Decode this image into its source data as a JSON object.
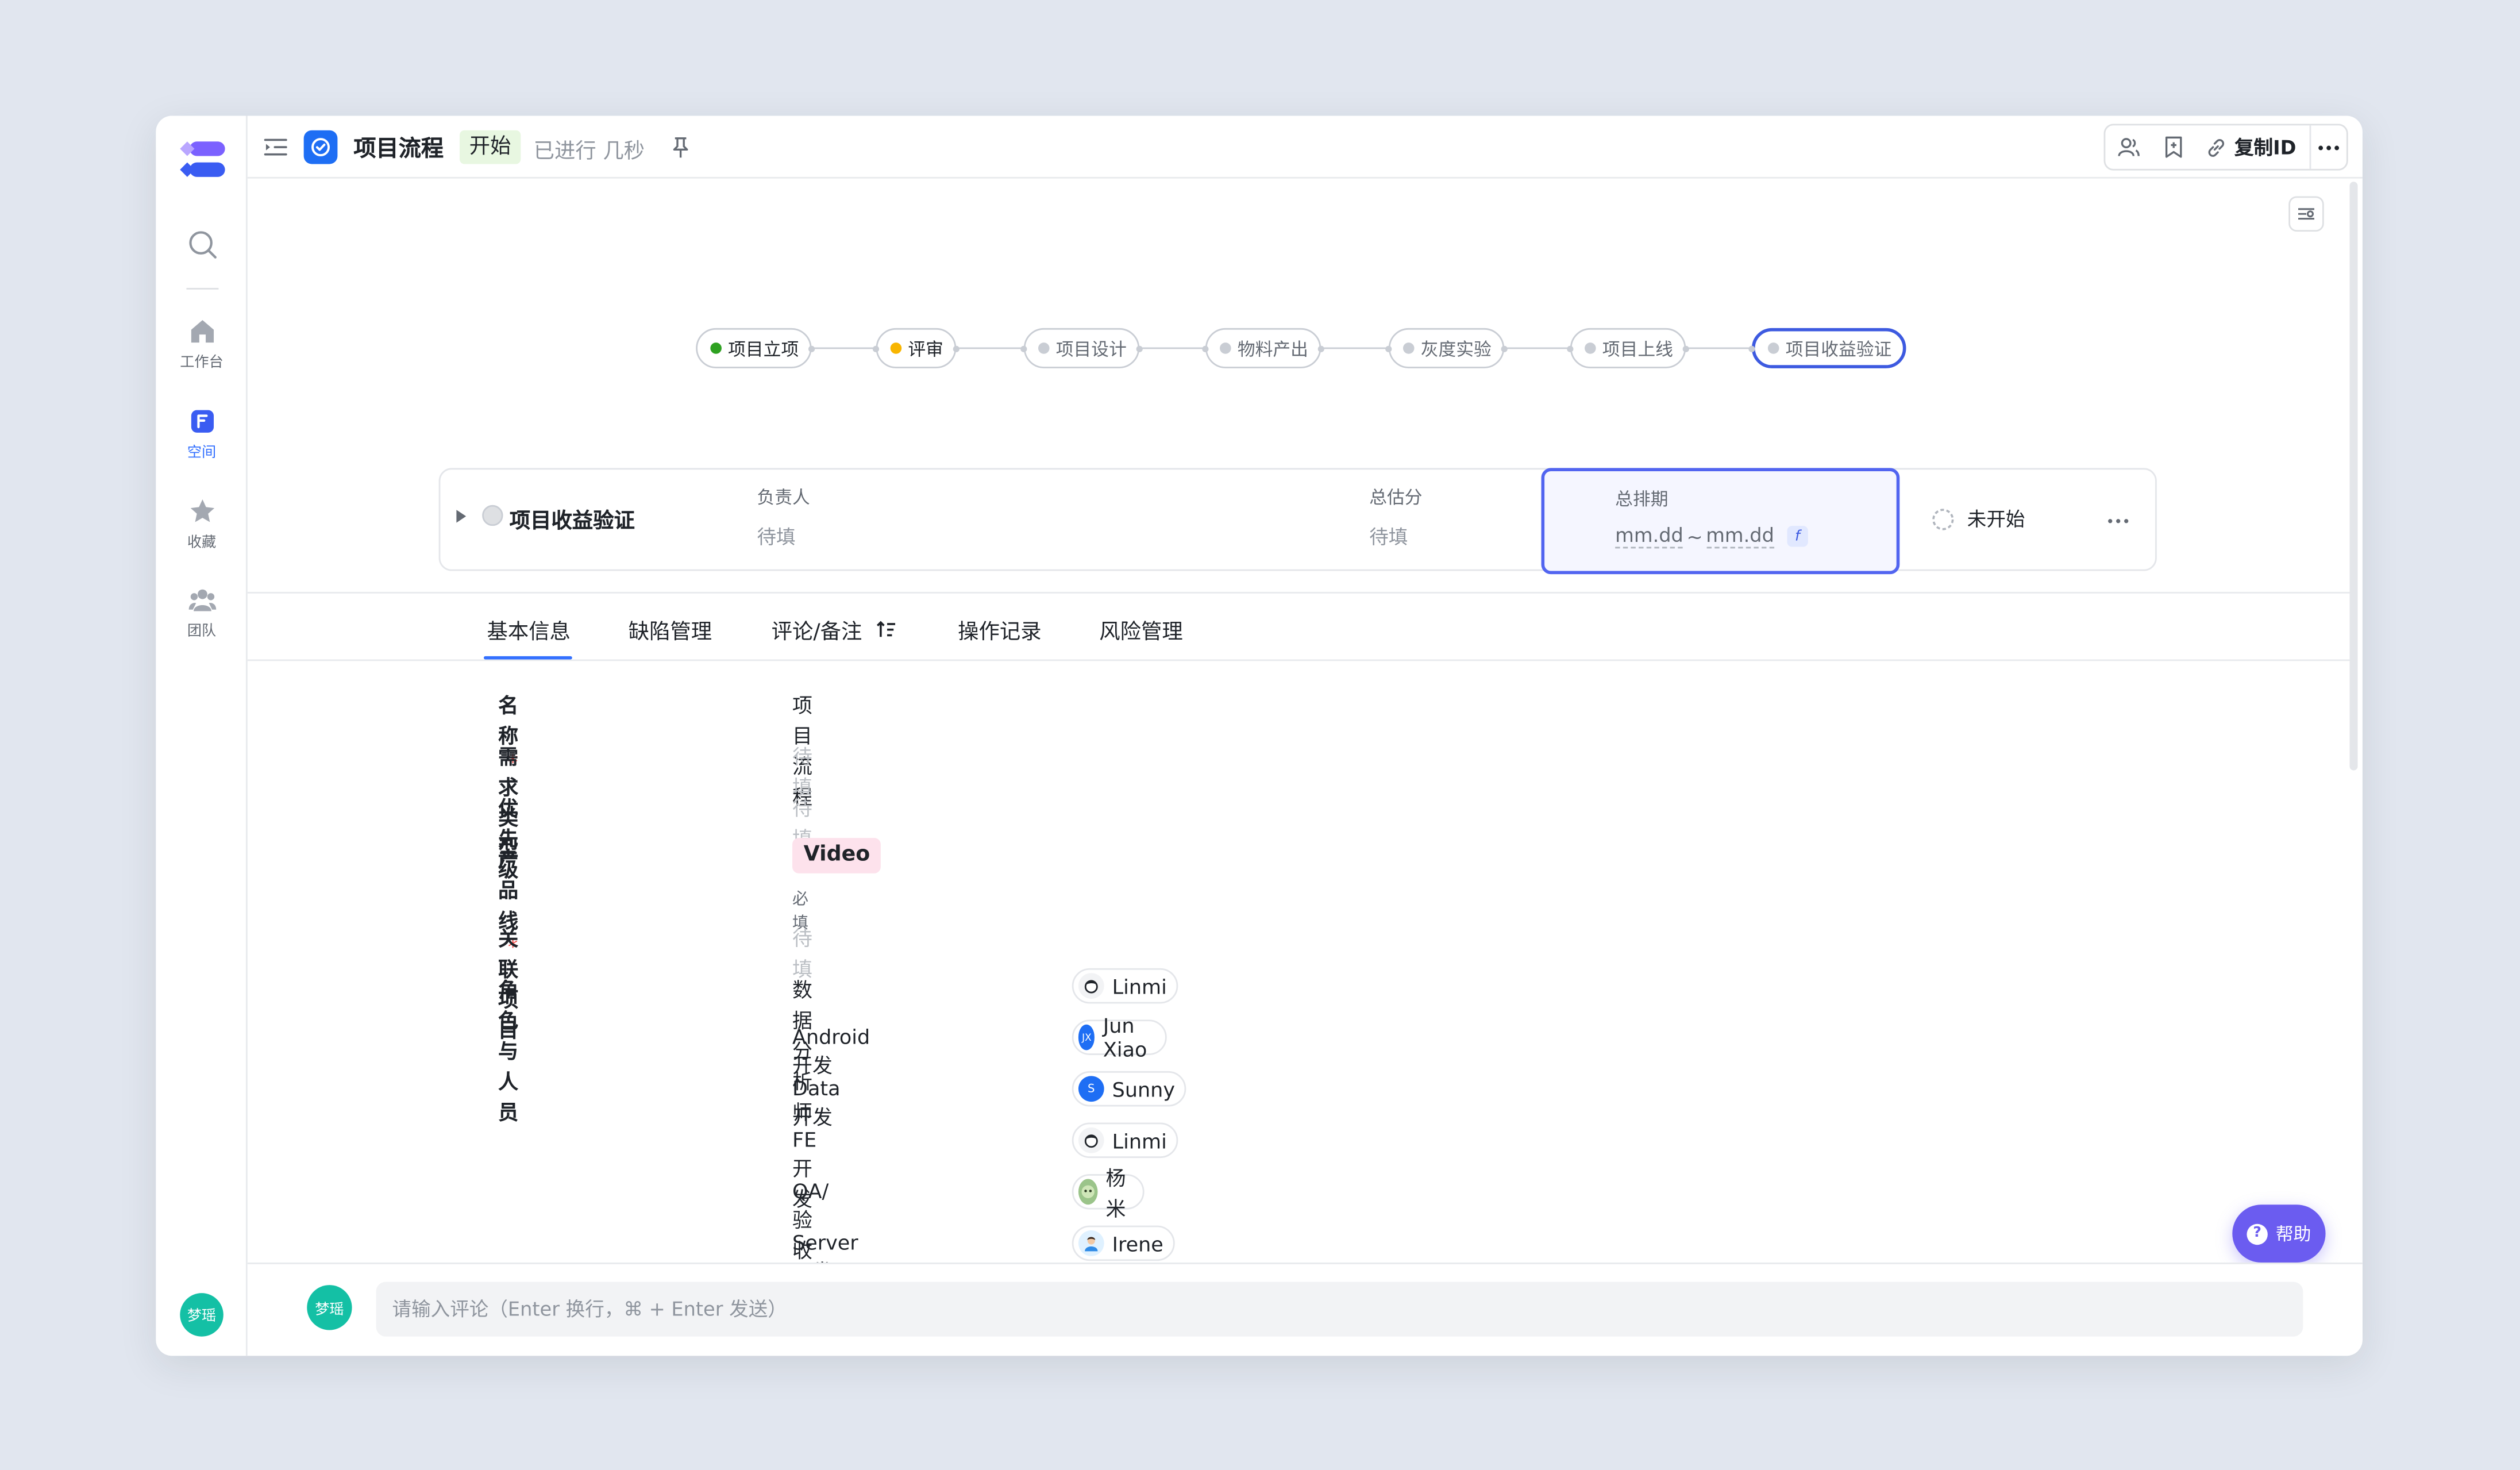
{
  "rail": {
    "items": [
      {
        "label": "工作台"
      },
      {
        "label": "空间"
      },
      {
        "label": "收藏"
      },
      {
        "label": "团队"
      }
    ],
    "user_initials": "梦瑶"
  },
  "header": {
    "title": "项目流程",
    "status": "开始",
    "elapsed": "已进行 几秒",
    "copy_id_label": "复制ID"
  },
  "pipeline": {
    "stages": [
      {
        "label": "项目立项",
        "state": "done"
      },
      {
        "label": "评审",
        "state": "current"
      },
      {
        "label": "项目设计",
        "state": "pending"
      },
      {
        "label": "物料产出",
        "state": "pending"
      },
      {
        "label": "灰度实验",
        "state": "pending"
      },
      {
        "label": "项目上线",
        "state": "pending"
      },
      {
        "label": "项目收益验证",
        "state": "selected"
      }
    ]
  },
  "node": {
    "name": "项目收益验证",
    "owner_label": "负责人",
    "owner_value": "待填",
    "score_label": "总估分",
    "score_value": "待填",
    "schedule_label": "总排期",
    "schedule_start": "mm.dd",
    "schedule_sep": "~",
    "schedule_end": "mm.dd",
    "status": "未开始"
  },
  "tabs": [
    {
      "label": "基本信息"
    },
    {
      "label": "缺陷管理"
    },
    {
      "label": "评论/备注"
    },
    {
      "label": "操作记录"
    },
    {
      "label": "风险管理"
    }
  ],
  "form": {
    "name_label": "名称",
    "name_value": "项目流程",
    "type_label": "需求类型",
    "type_value": "待填",
    "priority_label": "优先级",
    "priority_value": "待填",
    "product_label": "产品线",
    "product_value": "Video",
    "product_hint": "必填",
    "related_label": "关联项目",
    "related_value": "待填",
    "roles_label": "角色与人员",
    "required_mark": "*",
    "roles": [
      {
        "role": "数据分析师",
        "person": "Linmi",
        "avatar": "face"
      },
      {
        "role": "Android开发",
        "person": "Jun Xiao",
        "avatar": "JX"
      },
      {
        "role": "Data开发",
        "person": "Sunny",
        "avatar": "S"
      },
      {
        "role": "FE开发",
        "person": "Linmi",
        "avatar": "face"
      },
      {
        "role": "QA/验收人",
        "person": "杨米",
        "avatar": "photo"
      },
      {
        "role": "Server开发",
        "person": "Irene",
        "avatar": "photo2"
      }
    ]
  },
  "help": {
    "label": "帮助"
  },
  "comment": {
    "user_initials": "梦瑶",
    "placeholder": "请输入评论（Enter 换行，⌘ + Enter 发送）"
  },
  "colors": {
    "accent": "#3370ff",
    "selected_border": "#3d5ae0",
    "done": "#2ea121",
    "current": "#f8b500",
    "help": "#6b5cf0",
    "avatar_teal": "#14c0a5"
  }
}
